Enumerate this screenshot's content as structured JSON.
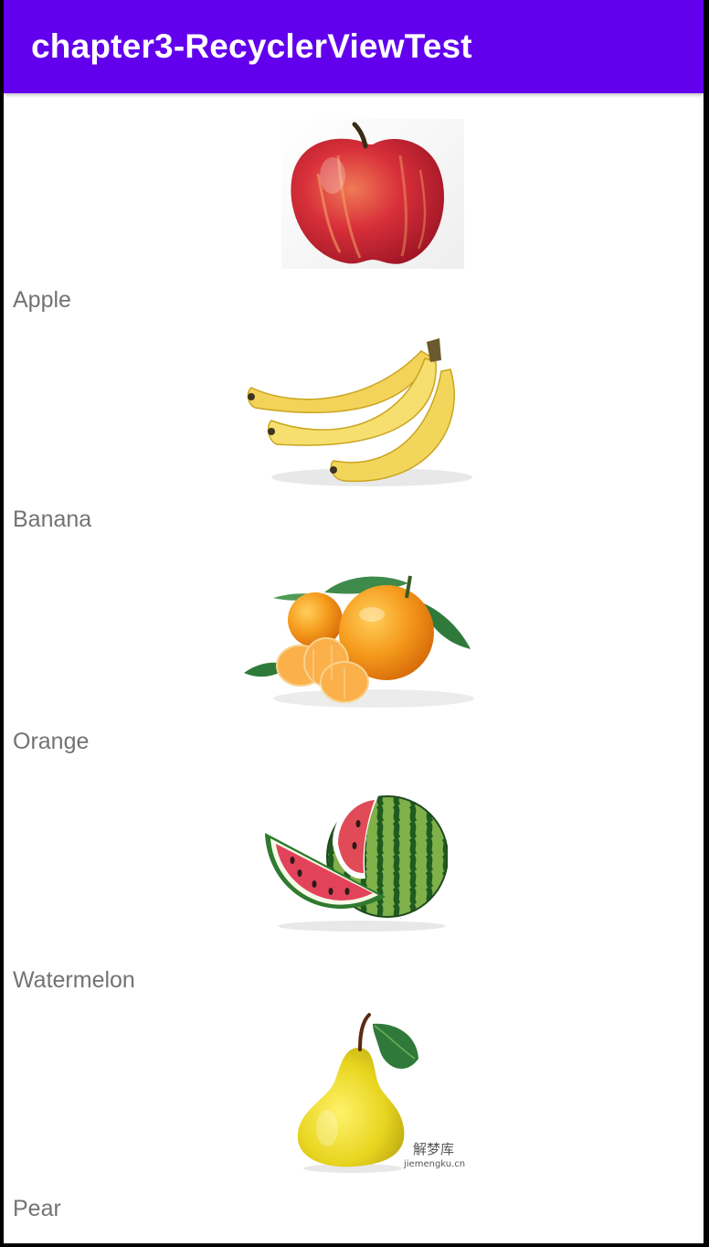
{
  "app_bar": {
    "title": "chapter3-RecyclerViewTest",
    "background": "#6200ee"
  },
  "fruits": [
    {
      "name": "Apple",
      "image": "apple-image"
    },
    {
      "name": "Banana",
      "image": "banana-image"
    },
    {
      "name": "Orange",
      "image": "orange-image"
    },
    {
      "name": "Watermelon",
      "image": "watermelon-image"
    },
    {
      "name": "Pear",
      "image": "pear-image"
    }
  ],
  "pear_watermark": {
    "cn": "解梦库",
    "url": "jiemengku.cn"
  }
}
